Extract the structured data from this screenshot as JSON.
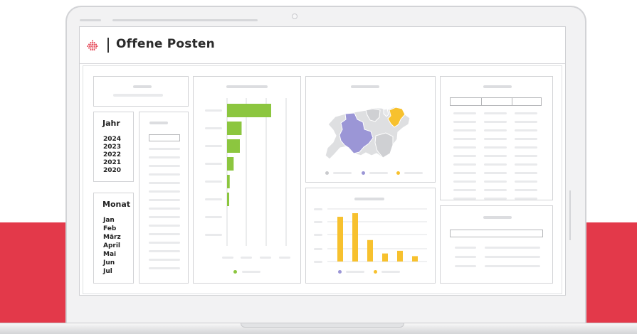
{
  "app": {
    "title": "Offene Posten",
    "brand_color": "#e3394a"
  },
  "filters": {
    "year": {
      "title": "Jahr",
      "options": [
        "2024",
        "2023",
        "2022",
        "2021",
        "2020"
      ]
    },
    "month": {
      "title": "Monat",
      "options": [
        "Jan",
        "Feb",
        "März",
        "April",
        "Mai",
        "Jun",
        "Jul"
      ]
    }
  },
  "colors": {
    "green": "#8cc63f",
    "yellow": "#f7c12e",
    "purple": "#9b96d6",
    "gray_region": "#d9dadc"
  },
  "icons": [
    "dotted-diamond-logo-icon",
    "camera-icon"
  ],
  "chart_data": [
    {
      "type": "bar",
      "orientation": "horizontal",
      "series": [
        {
          "values": [
            100,
            33,
            29,
            15,
            6,
            4
          ]
        }
      ],
      "grid": true,
      "legend": "bottom",
      "color": "#8cc63f"
    },
    {
      "type": "bar",
      "series": [
        {
          "values": [
            100,
            108,
            48,
            18,
            24,
            12
          ]
        }
      ],
      "grid": true,
      "legend": "bottom",
      "color": "#f7c12e"
    }
  ]
}
